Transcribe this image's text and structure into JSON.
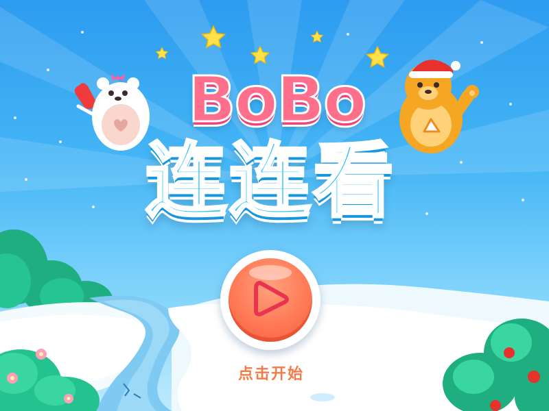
{
  "game": {
    "title_latin": "BoBo",
    "title_chinese": "连连看",
    "start_label": "点击开始"
  },
  "icons": {
    "play": "play-icon",
    "star": "star-icon",
    "polar_bear": "polar-bear-mascot",
    "brown_bear": "brown-bear-mascot"
  },
  "colors": {
    "sky_top": "#2d9cf0",
    "sky_bottom": "#bfeafd",
    "title_pink": "#ff6f8b",
    "title_blue": "#2cc3f6",
    "button_orange": "#ff7a55",
    "label_orange": "#f47a46"
  }
}
